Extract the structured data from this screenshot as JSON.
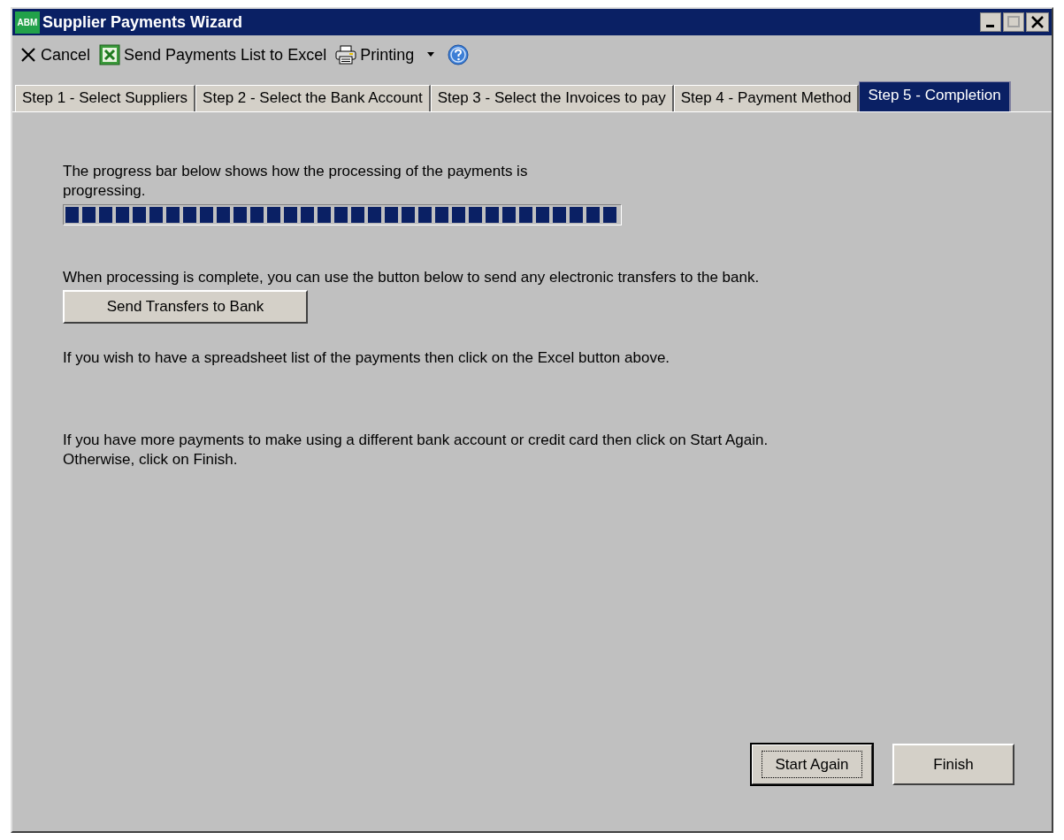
{
  "window": {
    "title": "Supplier Payments Wizard",
    "logo": "ABM"
  },
  "toolbar": [
    {
      "kind": "cancel",
      "label": "Cancel"
    },
    {
      "kind": "excel",
      "label": "Send Payments List to Excel"
    },
    {
      "kind": "print",
      "label": "Printing"
    },
    {
      "kind": "dropdown"
    },
    {
      "kind": "help"
    }
  ],
  "tabs": [
    {
      "label": "Step 1 - Select Suppliers",
      "selected": false
    },
    {
      "label": "Step 2 - Select the Bank Account",
      "selected": false
    },
    {
      "label": "Step 3 - Select the Invoices to pay",
      "selected": false
    },
    {
      "label": "Step 4 - Payment Method",
      "selected": false
    },
    {
      "label": "Step 5 - Completion",
      "selected": true
    }
  ],
  "page": {
    "progress_text": "The progress bar below shows how the processing of the payments is progressing.",
    "progress": {
      "level": 1
    },
    "transfer_text": "When processing is complete, you can use the button below to send any electronic transfers to the bank.",
    "transfer_button": "Send Transfers to Bank",
    "excel_text": "If you wish to have a spreadsheet list of the payments then click on the Excel button above.",
    "finish_text": "If you have more payments to make using a different bank account or credit card then click on Start Again. Otherwise, click on Finish."
  },
  "buttons": [
    {
      "label": "Start Again",
      "default": true
    },
    {
      "label": "Finish",
      "default": false
    }
  ]
}
